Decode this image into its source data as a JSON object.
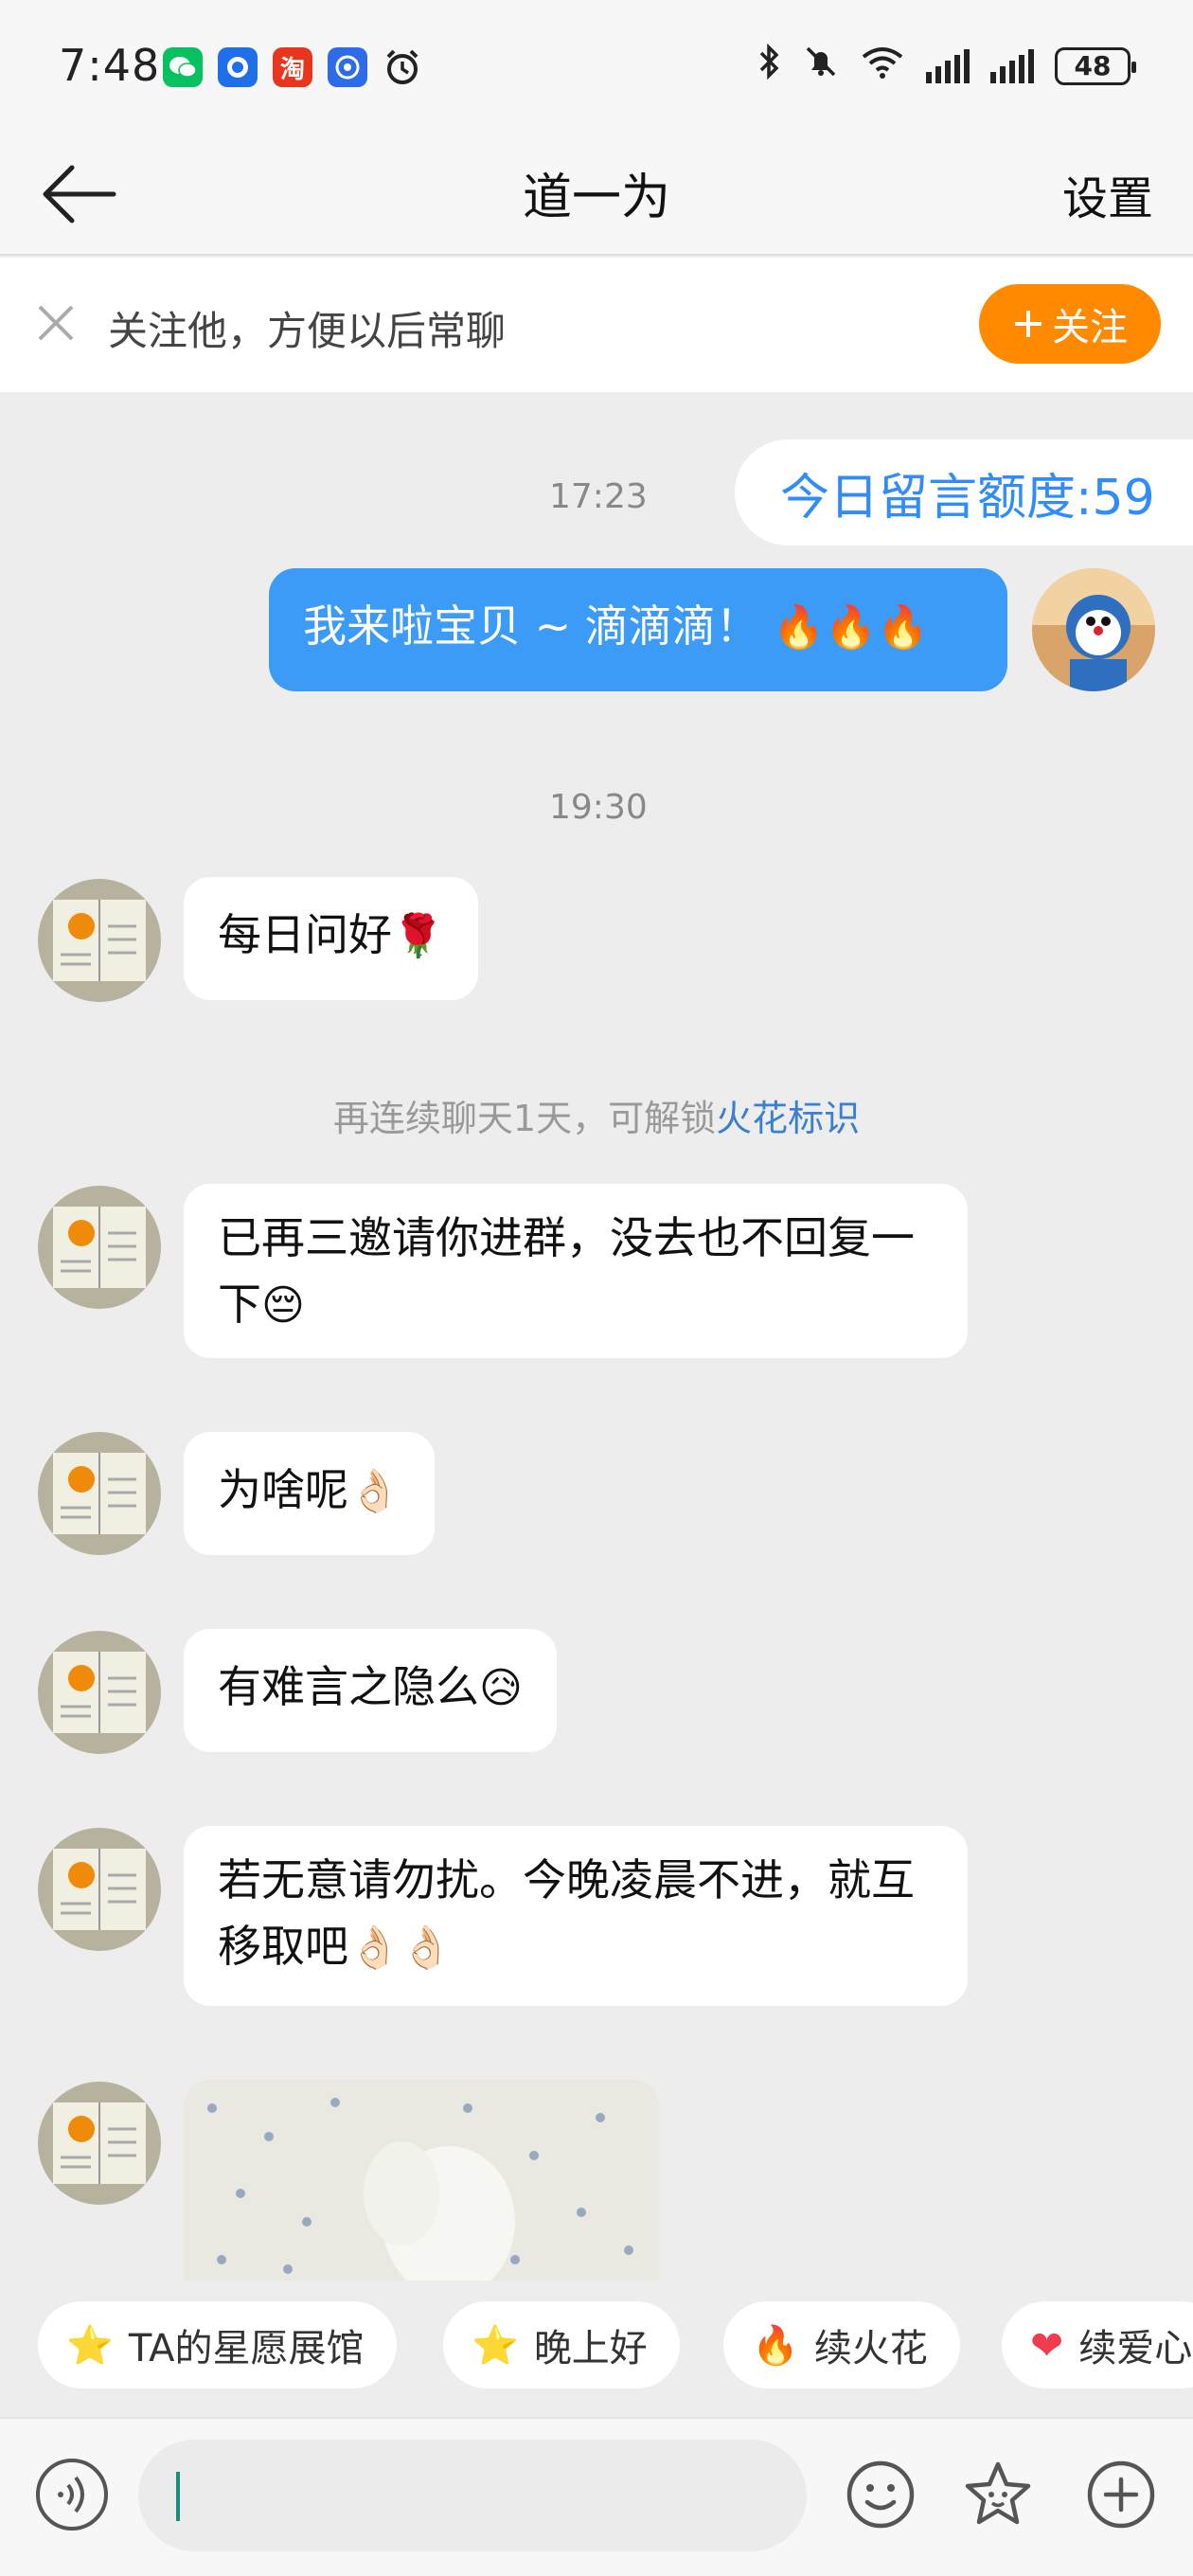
{
  "status_bar": {
    "time": "7:48",
    "apps": [
      {
        "icon": "wechat-icon",
        "color": "#07C160",
        "glyph": "●"
      },
      {
        "icon": "fish-app-icon",
        "color": "#1E6FE8",
        "glyph": "◉"
      },
      {
        "icon": "taobao-icon",
        "color": "#E8351E",
        "glyph": "淘"
      },
      {
        "icon": "app-shield-icon",
        "color": "#2D6BE8",
        "glyph": "◎"
      }
    ],
    "battery": "48"
  },
  "nav": {
    "title": "道一为",
    "settings_label": "设置"
  },
  "follow_banner": {
    "text": "关注他，方便以后常聊",
    "button_label": "关注"
  },
  "messages": {
    "time_1": "17:23",
    "quota": "今日留言额度:59",
    "mine_1": "我来啦宝贝 ~ 滴滴滴！",
    "mine_1_emoji": "🔥🔥🔥",
    "time_2": "19:30",
    "m1_text": "每日问好",
    "m1_emoji": "🌹",
    "system_prefix": "再连续聊天1天，可解锁",
    "system_highlight": "火花标识",
    "m2_text": "已再三邀请你进群，没去也不回复一下",
    "m2_emoji": "😔",
    "m3_text": "为啥呢",
    "m3_emoji": "👌🏻",
    "m4_text": "有难言之隐么",
    "m4_emoji": "😥",
    "m5_text": "若无意请勿扰。今晚凌晨不进，就互移取吧",
    "m5_emoji": "👌🏻👌🏻"
  },
  "quick_replies": [
    {
      "icon": "star-face-icon",
      "glyph": "⭐",
      "label": "TA的星愿展馆"
    },
    {
      "icon": "star-face-icon",
      "glyph": "⭐",
      "label": "晚上好"
    },
    {
      "icon": "fire-icon",
      "glyph": "🔥",
      "label": "续火花"
    },
    {
      "icon": "heart-icon",
      "glyph": "❤",
      "label": "续爱心"
    }
  ],
  "colors": {
    "accent_blue": "#3D9BF8",
    "follow_orange": "#FF8A00",
    "link_blue": "#3A7FD0"
  }
}
